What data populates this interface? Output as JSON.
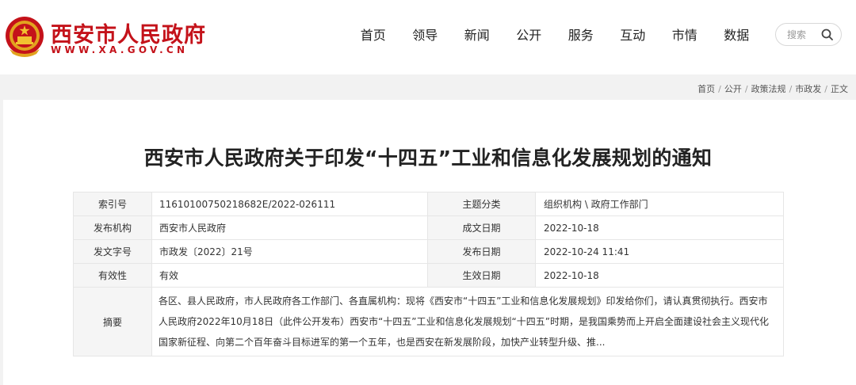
{
  "header": {
    "site_name": "西安市人民政府",
    "site_url": "WWW.XA.GOV.CN",
    "brand_color": "#c4121a"
  },
  "nav": {
    "items": [
      "首页",
      "领导",
      "新闻",
      "公开",
      "服务",
      "互动",
      "市情",
      "数据"
    ]
  },
  "search": {
    "placeholder": "搜索",
    "icon": "search-icon"
  },
  "breadcrumb": [
    "首页",
    "公开",
    "政策法规",
    "市政发",
    "正文"
  ],
  "article": {
    "title": "西安市人民政府关于印发“十四五”工业和信息化发展规划的通知"
  },
  "info": {
    "index_label": "索引号",
    "index_value": "11610100750218682E/2022-026111",
    "topic_label": "主题分类",
    "topic_value": "组织机构 \\ 政府工作部门",
    "issuer_label": "发布机构",
    "issuer_value": "西安市人民政府",
    "written_label": "成文日期",
    "written_value": "2022-10-18",
    "docno_label": "发文字号",
    "docno_value": "市政发〔2022〕21号",
    "publish_label": "发布日期",
    "publish_value": "2022-10-24 11:41",
    "validity_label": "有效性",
    "validity_value": "有效",
    "effective_label": "生效日期",
    "effective_value": "2022-10-18",
    "summary_label": "摘要",
    "summary_value": "各区、县人民政府，市人民政府各工作部门、各直属机构：现将《西安市“十四五”工业和信息化发展规划》印发给你们，请认真贯彻执行。西安市人民政府2022年10月18日（此件公开发布）西安市“十四五”工业和信息化发展规划“十四五”时期，是我国乘势而上开启全面建设社会主义现代化国家新征程、向第二个百年奋斗目标进军的第一个五年，也是西安在新发展阶段，加快产业转型升级、推..."
  }
}
